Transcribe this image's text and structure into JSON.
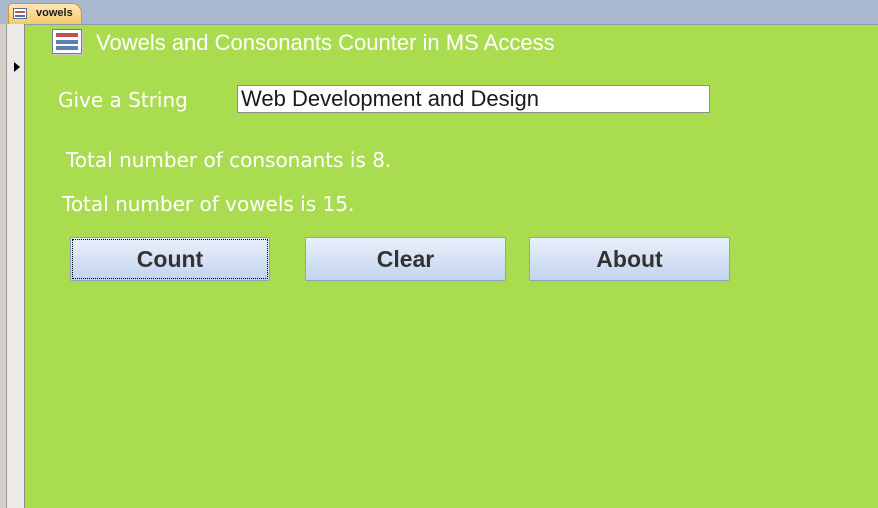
{
  "tab": {
    "label": "vowels"
  },
  "form": {
    "title": "Vowels and Consonants Counter in MS Access",
    "input_label": "Give a String",
    "input_value": "Web Development and Design",
    "consonants_text": "Total number of consonants is  8.",
    "vowels_text": "Total number of vowels is  15."
  },
  "buttons": {
    "count": "Count",
    "clear": "Clear",
    "about": "About"
  },
  "colors": {
    "background": "#aadc50",
    "button": "#c3d4ee",
    "tab": "#f7c96a"
  }
}
